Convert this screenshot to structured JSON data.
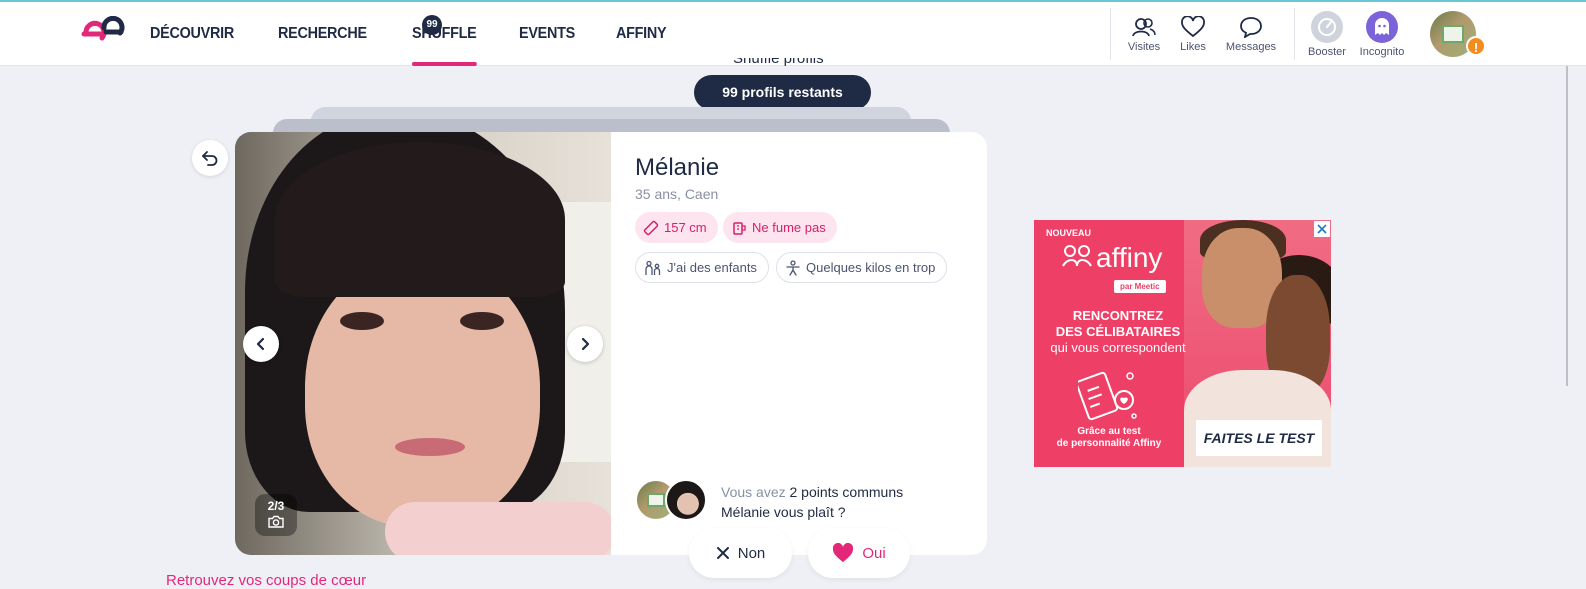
{
  "header": {
    "nav": [
      {
        "label": "DÉCOUVRIR",
        "active": false
      },
      {
        "label": "RECHERCHE",
        "active": false
      },
      {
        "label": "SHUFFLE",
        "active": true
      },
      {
        "label": "EVENTS",
        "active": false
      },
      {
        "label": "AFFINY",
        "active": false
      }
    ],
    "shuffle_badge": "99",
    "actions": [
      {
        "label": "Visites",
        "icon": "visits-icon"
      },
      {
        "label": "Likes",
        "icon": "heart-outline-icon"
      },
      {
        "label": "Messages",
        "icon": "speech-bubble-icon"
      }
    ],
    "boosts": [
      {
        "label": "Booster",
        "icon": "booster-icon"
      },
      {
        "label": "Incognito",
        "icon": "ghost-icon"
      }
    ],
    "alert_badge": "!"
  },
  "shuffle": {
    "remaining": "99 profils restants",
    "header_text_cut": "Shuffle profils"
  },
  "profile": {
    "name": "Mélanie",
    "meta": "35 ans, Caen",
    "photo_counter": "2/3",
    "chips_primary": [
      {
        "label": "157 cm",
        "icon": "ruler-icon"
      },
      {
        "label": "Ne fume pas",
        "icon": "no-smoking-icon"
      }
    ],
    "chips_secondary": [
      {
        "label": "J'ai des enfants",
        "icon": "family-icon"
      },
      {
        "label": "Quelques kilos en trop",
        "icon": "body-icon"
      }
    ],
    "common_prefix": "Vous avez ",
    "common_bold": "2 points communs",
    "question": "Mélanie vous plaît ?"
  },
  "actions": {
    "no": "Non",
    "yes": "Oui"
  },
  "footer": {
    "link": "Retrouvez vos coups de cœur"
  },
  "ad": {
    "badge": "NOUVEAU",
    "brand": "affiny",
    "brand_sub": "par Meetic",
    "headline_1": "RENCONTREZ",
    "headline_2": "DES CÉLIBATAIRES",
    "headline_3": "qui vous correspondent",
    "small_1": "Grâce au test",
    "small_2": "de personnalité Affiny",
    "cta": "FAITES LE TEST"
  },
  "colors": {
    "brand_pink": "#e3287a",
    "navy": "#1f2a44",
    "ad_red": "#ee3f66"
  }
}
